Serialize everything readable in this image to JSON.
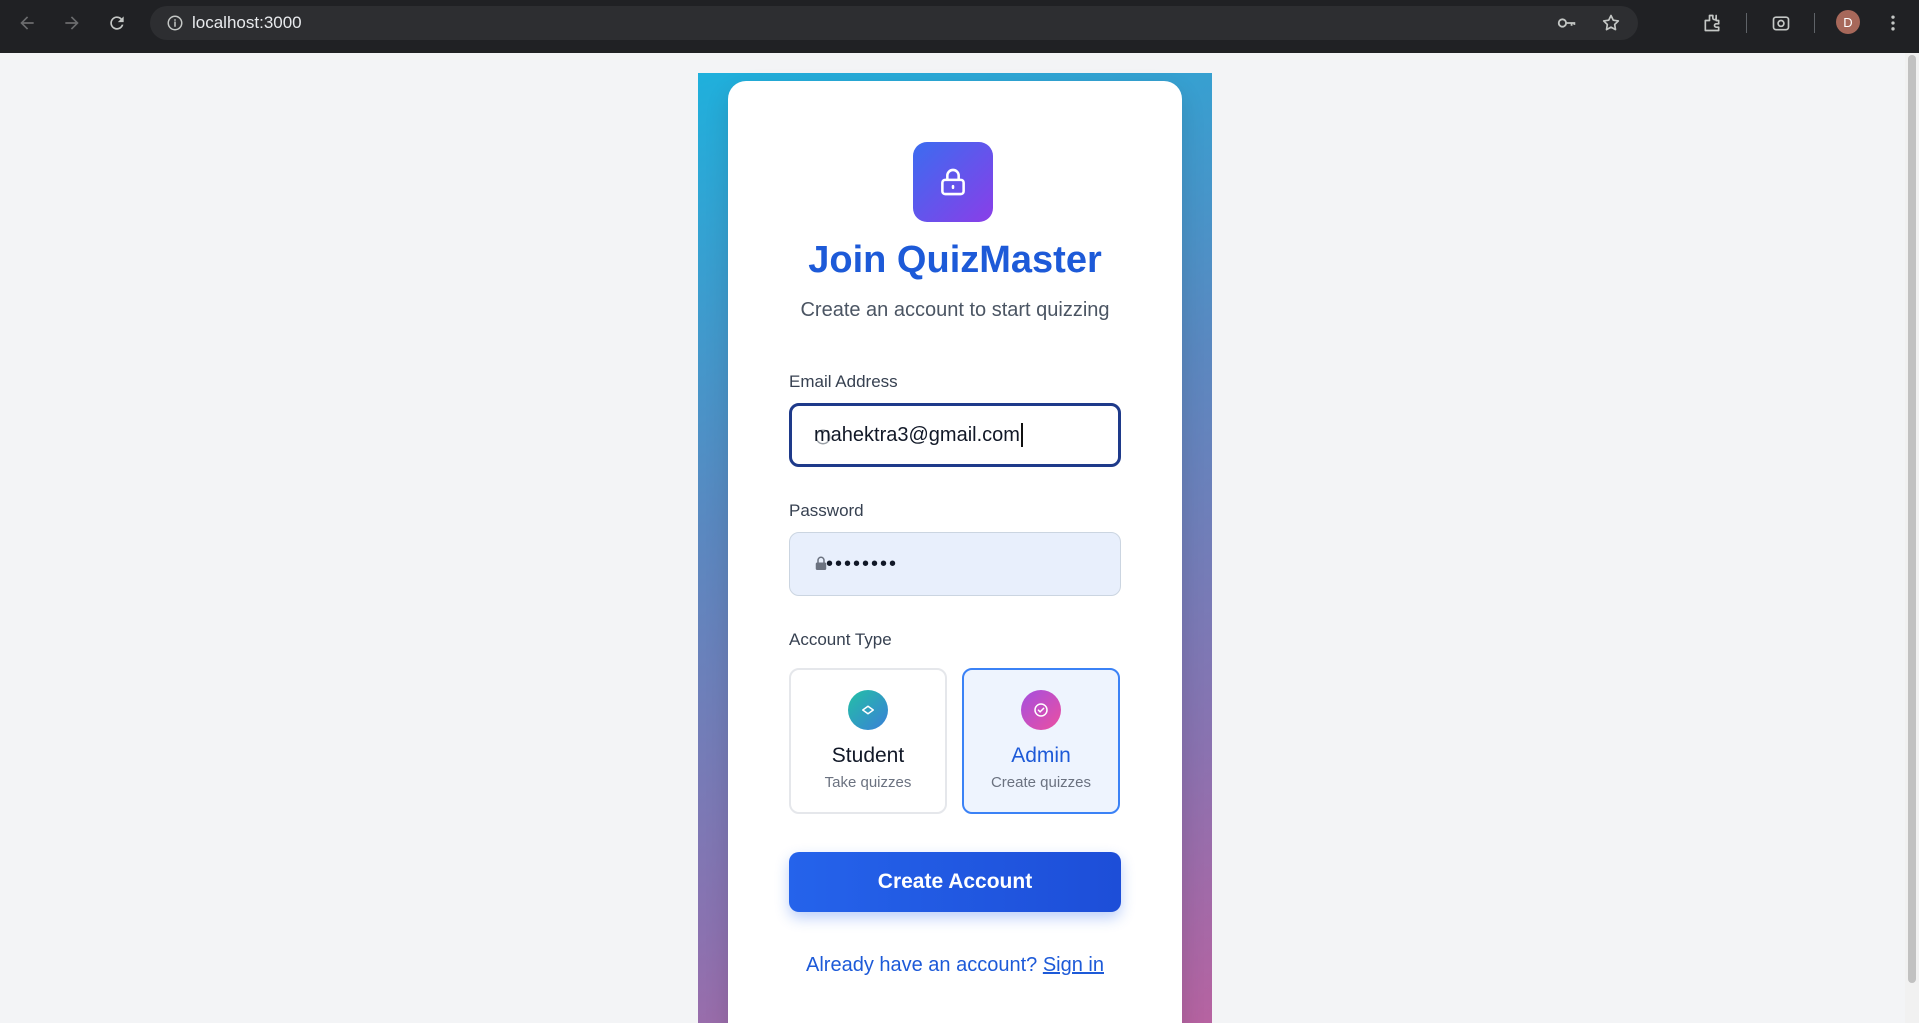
{
  "browser": {
    "url": "localhost:3000",
    "profile_initial": "D"
  },
  "form": {
    "title": "Join QuizMaster",
    "subtitle": "Create an account to start quizzing",
    "email": {
      "label": "Email Address",
      "value": "mahektra3@gmail.com"
    },
    "password": {
      "label": "Password",
      "masked_value": "••••••••"
    },
    "account_type": {
      "label": "Account Type",
      "options": [
        {
          "name": "Student",
          "description": "Take quizzes",
          "selected": false
        },
        {
          "name": "Admin",
          "description": "Create quizzes",
          "selected": true
        }
      ]
    },
    "submit_label": "Create Account",
    "signin_prompt": "Already have an account?",
    "signin_link": "Sign in"
  },
  "colors": {
    "primary": "#1d5ad8",
    "button": "#2563eb",
    "selected_border": "#3b82f6"
  }
}
